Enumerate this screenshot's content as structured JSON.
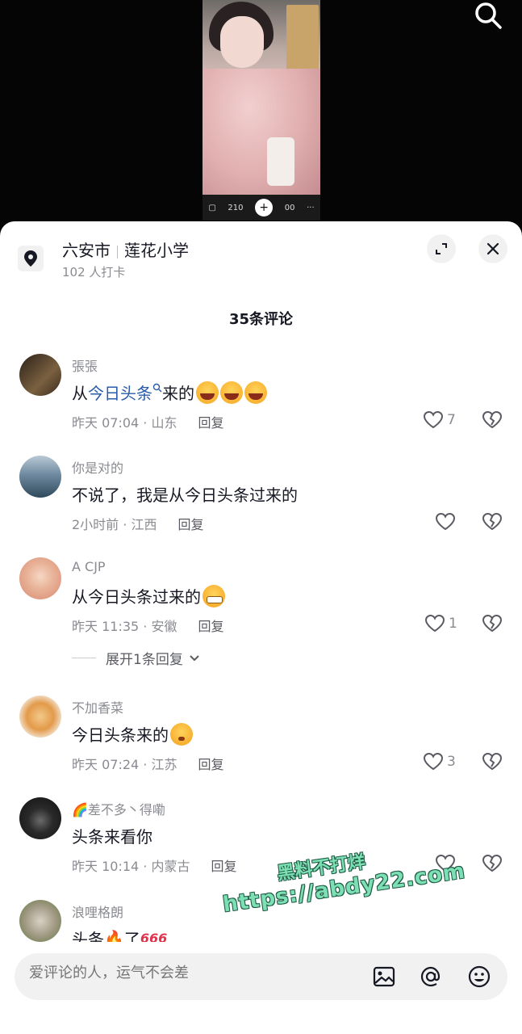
{
  "video": {
    "bar_count": "210",
    "bar_plus": "+",
    "bar_right": "00",
    "bar_more": "···"
  },
  "location": {
    "city": "六安市",
    "place": "莲花小学",
    "checkins": "102 人打卡"
  },
  "comments_header": "35条评论",
  "comments": [
    {
      "user": "張張",
      "text_pre": "从",
      "text_link": "今日头条",
      "text_post": "来的",
      "time_loc": "昨天 07:04 · 山东",
      "reply": "回复",
      "likes": "7",
      "avatar_color": "#5b4a3a"
    },
    {
      "user": "你是对的",
      "text": "不说了，我是从今日头条过来的",
      "time_loc": "2小时前 · 江西",
      "reply": "回复",
      "likes": "",
      "avatar_color": "#3c5a6e"
    },
    {
      "user": "A    CJP",
      "text": "从今日头条过来的",
      "time_loc": "昨天 11:35 · 安徽",
      "reply": "回复",
      "likes": "1",
      "avatar_color": "#e8b8a0"
    },
    {
      "user": "不加香菜",
      "text": "今日头条来的",
      "time_loc": "昨天 07:24 · 江苏",
      "reply": "回复",
      "likes": "3",
      "avatar_color": "#d9a46a"
    },
    {
      "user": "差不多丶得嘞",
      "text": "头条来看你",
      "time_loc": "昨天 10:14 · 内蒙古",
      "reply": "回复",
      "likes": "",
      "avatar_color": "#222222"
    },
    {
      "user": "浪哩格朗",
      "text_pre": "头条",
      "text_post": "了",
      "tag": "666",
      "avatar_color": "#a39a86"
    }
  ],
  "expand_replies": "展开1条回复",
  "watermark": {
    "line1": "黑料不打烊",
    "line2": "https://abdy22.com"
  },
  "input": {
    "placeholder": "爱评论的人，运气不会差"
  },
  "icons": {
    "search": "search-icon",
    "location": "location-pin-icon",
    "expand": "expand-icon",
    "close": "close-icon",
    "like": "heart-icon",
    "dislike": "broken-heart-icon",
    "image": "image-icon",
    "mention": "at-icon",
    "emoji": "emoji-icon"
  },
  "colors": {
    "link": "#2a5caa",
    "muted": "#8a8b91",
    "watermark": "#7de0b4"
  }
}
